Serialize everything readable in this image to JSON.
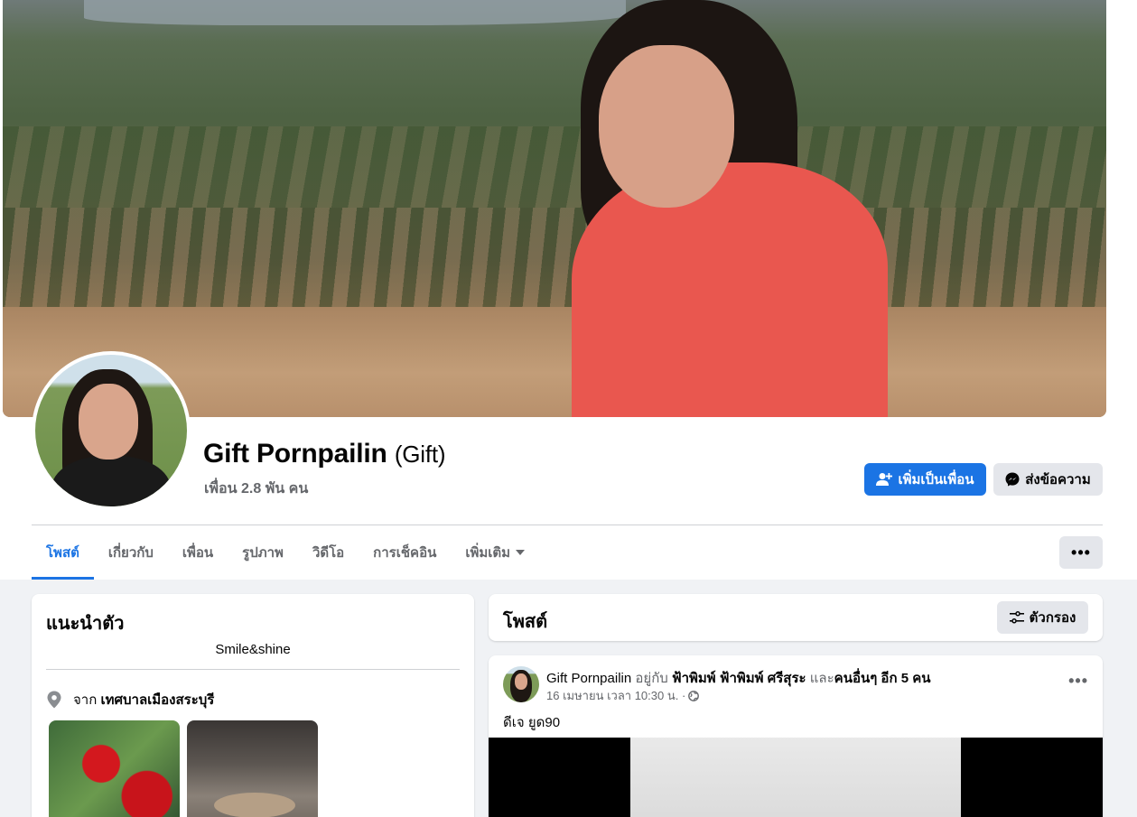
{
  "profile": {
    "name": "Gift Pornpailin",
    "nickname": "(Gift)",
    "friends": "เพื่อน 2.8 พัน คน"
  },
  "actions": {
    "add_friend": "เพิ่มเป็นเพื่อน",
    "message": "ส่งข้อความ"
  },
  "tabs": [
    {
      "label": "โพสต์"
    },
    {
      "label": "เกี่ยวกับ"
    },
    {
      "label": "เพื่อน"
    },
    {
      "label": "รูปภาพ"
    },
    {
      "label": "วิดีโอ"
    },
    {
      "label": "การเช็คอิน"
    },
    {
      "label": "เพิ่มเติม"
    }
  ],
  "intro": {
    "title": "แนะนำตัว",
    "bio": "Smile&shine",
    "from_prefix": "จาก",
    "from_place": "เทศบาลเมืองสระบุรี"
  },
  "posts": {
    "title": "โพสต์",
    "filter_label": "ตัวกรอง"
  },
  "post": {
    "author": "Gift Pornpailin",
    "with_text": "อยู่กับ",
    "tagged": "ฟ้าพิมพ์ ฟ้าพิมพ์ ศรีสุระ",
    "and_text": "และ",
    "others": "คนอื่นๆ อีก 5 คน",
    "timestamp": "16 เมษายน เวลา 10:30 น. ·",
    "text": "ดีเจ ยูด90"
  },
  "colors": {
    "accent": "#1b74e4",
    "background": "#f0f2f5",
    "secondary_button": "#e4e6eb",
    "muted_text": "#65676b"
  }
}
